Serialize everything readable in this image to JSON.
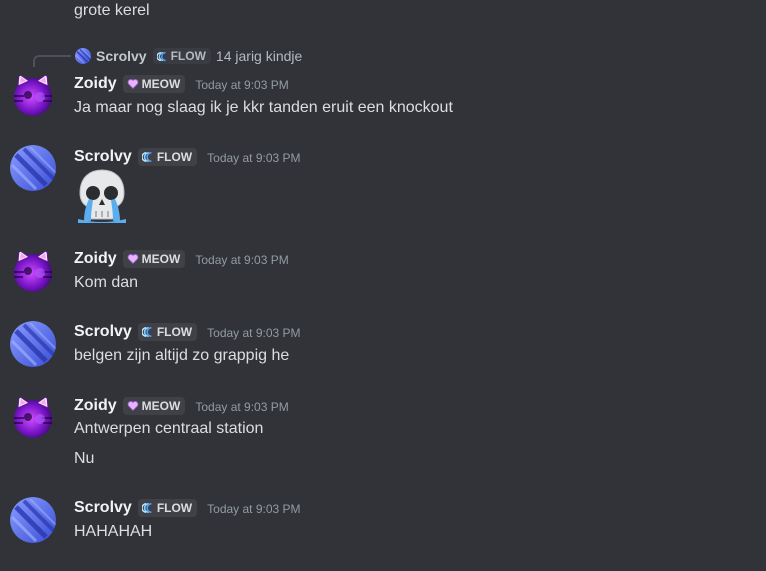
{
  "top_message": {
    "text": "grote kerel"
  },
  "reply_preview": {
    "username": "Scrolvy",
    "tag": "FLOW",
    "text": "14 jarig kindje"
  },
  "messages": [
    {
      "username": "Zoidy",
      "tag": "MEOW",
      "timestamp": "Today at 9:03 PM",
      "lines": [
        "Ja maar nog slaag ik je kkr tanden eruit een knockout"
      ]
    },
    {
      "username": "Scrolvy",
      "tag": "FLOW",
      "timestamp": "Today at 9:03 PM",
      "emoji": "crying-skull"
    },
    {
      "username": "Zoidy",
      "tag": "MEOW",
      "timestamp": "Today at 9:03 PM",
      "lines": [
        "Kom dan"
      ]
    },
    {
      "username": "Scrolvy",
      "tag": "FLOW",
      "timestamp": "Today at 9:03 PM",
      "lines": [
        "belgen zijn altijd zo grappig he"
      ]
    },
    {
      "username": "Zoidy",
      "tag": "MEOW",
      "timestamp": "Today at 9:03 PM",
      "lines": [
        "Antwerpen centraal station",
        "Nu"
      ]
    },
    {
      "username": "Scrolvy",
      "tag": "FLOW",
      "timestamp": "Today at 9:03 PM",
      "lines": [
        "HAHAHAH"
      ]
    }
  ],
  "colors": {
    "background": "#313338",
    "username": "#f2f3f5",
    "message_text": "#dbdee1",
    "timestamp": "#949ba4",
    "tag_background": "#3f4147"
  }
}
